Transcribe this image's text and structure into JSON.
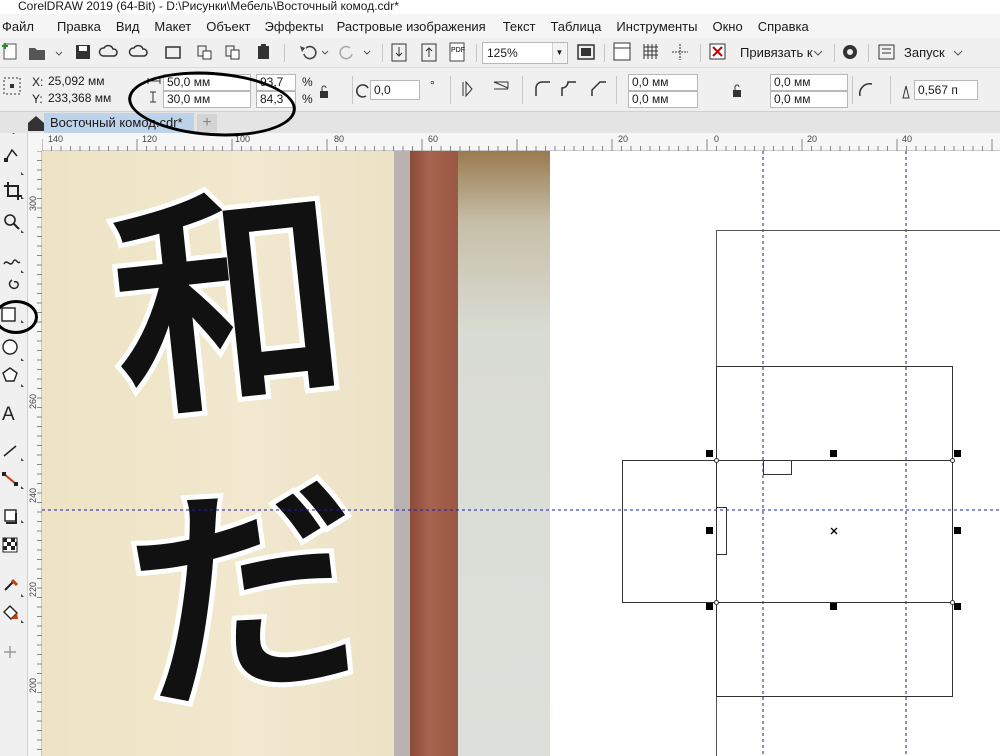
{
  "window": {
    "title": "CorelDRAW 2019 (64-Bit) - D:\\Рисунки\\Мебель\\Восточный комод.cdr*"
  },
  "menu": [
    "Файл",
    "Правка",
    "Вид",
    "Макет",
    "Объект",
    "Эффекты",
    "Растровые изображения",
    "Текст",
    "Таблица",
    "Инструменты",
    "Окно",
    "Справка"
  ],
  "toolbar": {
    "zoom_value": "125%",
    "snap_label": "Привязать к",
    "launch_label": "Запуск",
    "pdf_label": "PDF"
  },
  "property_bar": {
    "x_label": "X:",
    "x_value": "25,092 мм",
    "y_label": "Y:",
    "y_value": "233,368 мм",
    "width_value": "50,0 мм",
    "height_value": "30,0 мм",
    "scale_x": "93,7",
    "scale_y": "84,3",
    "percent_symbol": "%",
    "rotation_value": "0,0",
    "degree_symbol": "°",
    "corner_tl": "0,0 мм",
    "corner_bl": "0,0 мм",
    "corner_tr": "0,0 мм",
    "corner_br": "0,0 мм",
    "outline_width": "0,567 п"
  },
  "document_tab": {
    "label": "Восточный комод.cdr*"
  },
  "rulers": {
    "horizontal_labels": [
      "140",
      "120",
      "100",
      "80",
      "60",
      "20",
      "0",
      "20",
      "40"
    ],
    "vertical_labels": [
      "300",
      "260",
      "240",
      "220",
      "200"
    ]
  },
  "photo": {
    "glyph_1": "和",
    "glyph_2": "だ"
  },
  "colors": {
    "accent_tab": "#bcd3ea",
    "guideline": "#1a1aa0",
    "annotation": "#000000"
  },
  "icons": {
    "toolbox": [
      "pick-tool-icon",
      "shape-tool-icon",
      "crop-tool-icon",
      "zoom-tool-icon",
      "freehand-tool-icon",
      "artistic-media-icon",
      "rectangle-tool-icon",
      "ellipse-tool-icon",
      "polygon-tool-icon",
      "text-tool-icon",
      "parallel-dimension-icon",
      "connector-tool-icon",
      "drop-shadow-icon",
      "transparency-icon",
      "eyedropper-icon",
      "interactive-fill-icon",
      "add-tool-icon"
    ]
  }
}
